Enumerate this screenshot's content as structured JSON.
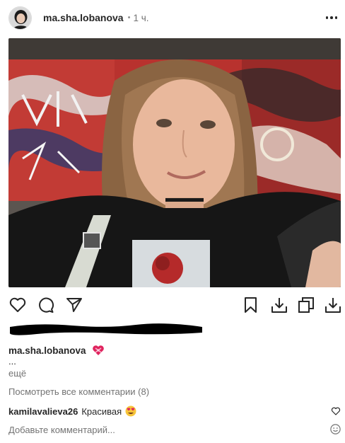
{
  "post": {
    "username": "ma.sha.lobanova",
    "separator": "•",
    "time": "1 ч.",
    "icons": {
      "more": "more-horizontal-icon",
      "like": "heart-icon",
      "comment": "comment-icon",
      "share": "send-icon",
      "save": "bookmark-icon",
      "download": "download-icon",
      "copy": "copy-icon",
      "download_alt": "download-icon"
    },
    "likes_text_redacted": true
  },
  "caption": {
    "username": "ma.sha.lobanova",
    "emoji": "heart-with-ribbon",
    "ellipsis": "...",
    "more_label": "ещё"
  },
  "comments": {
    "view_all_label": "Посмотреть все комментарии (8)",
    "items": [
      {
        "username": "kamilavalieva26",
        "text": "Красивая",
        "emoji": "heart-eyes"
      }
    ]
  },
  "add_comment": {
    "placeholder": "Добавьте комментарий..."
  }
}
